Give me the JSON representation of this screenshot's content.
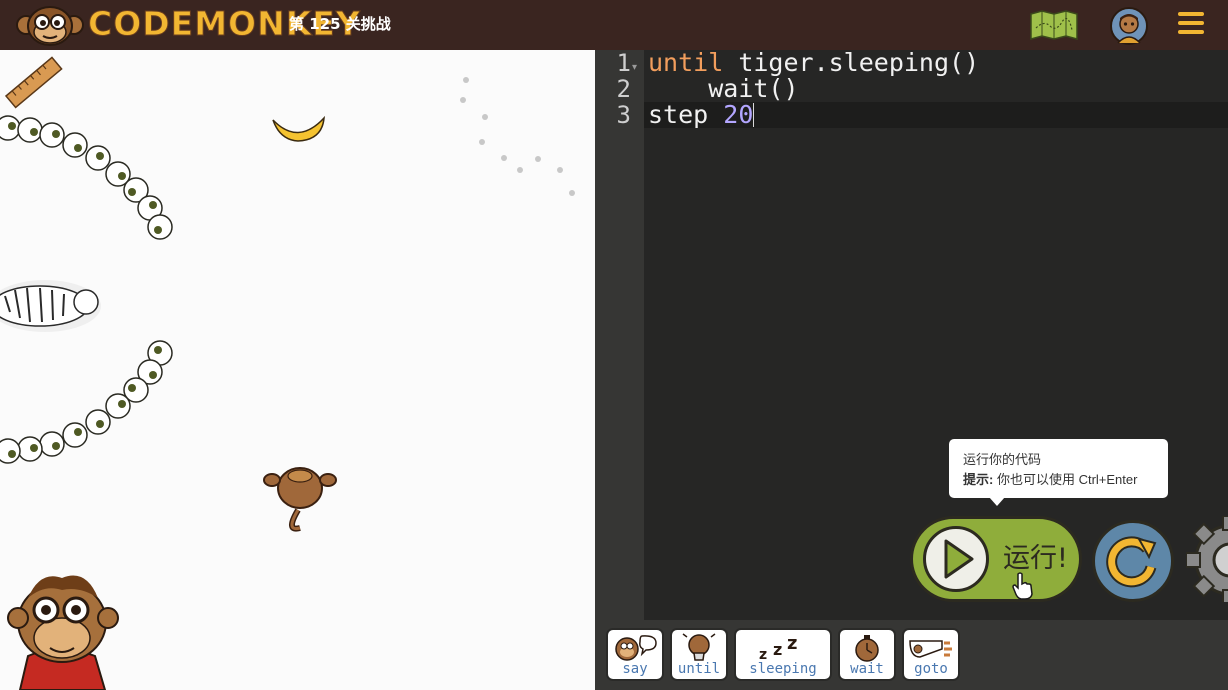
{
  "header": {
    "logo_text": "CODEMONKEY",
    "level_title": "第 125 关挑战",
    "icons": [
      "monkey-logo-icon",
      "map-icon",
      "user-avatar-icon",
      "hamburger-menu-icon"
    ]
  },
  "scene": {
    "objects": [
      "ruler-icon",
      "banana-icon",
      "tiger-icon",
      "monkey-icon",
      "bush-arc-icon",
      "paw-prints-icon",
      "mascot-character-icon"
    ]
  },
  "editor": {
    "line_numbers": [
      "1",
      "2",
      "3"
    ],
    "lines": [
      {
        "keyword": "until",
        "rest": " tiger.sleeping()"
      },
      {
        "indent": "    ",
        "text": "wait()"
      },
      {
        "text": "step ",
        "number": "20"
      }
    ]
  },
  "tooltip": {
    "title": "运行你的代码",
    "hint_label": "提示:",
    "hint_text": " 你也可以使用 Ctrl+Enter"
  },
  "controls": {
    "run_label": "运行!"
  },
  "snippets": [
    {
      "label": "say",
      "icon": "monkey-speech-icon"
    },
    {
      "label": "until",
      "icon": "lightbulb-icon"
    },
    {
      "label": "sleeping",
      "icon": "zzz-icon"
    },
    {
      "label": "wait",
      "icon": "stopwatch-icon"
    },
    {
      "label": "goto",
      "icon": "goto-arrow-icon"
    }
  ],
  "colors": {
    "header_bg": "#3a2520",
    "logo": "#f2b632",
    "editor_bg": "#262625",
    "keyword": "#f29e5d",
    "number": "#b3a6ff",
    "run_button": "#8fad3b",
    "reset_button": "#5e87a8",
    "snippet_label": "#4a78b0"
  }
}
